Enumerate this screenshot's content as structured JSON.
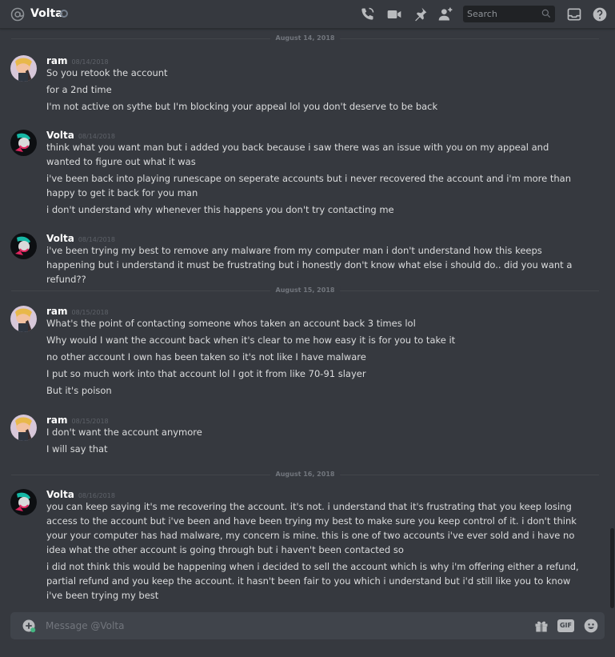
{
  "header": {
    "channel_name": "Volta",
    "search_placeholder": "Search",
    "icons": [
      "at-icon",
      "status-offline-icon",
      "call-icon",
      "video-icon",
      "pin-icon",
      "add-friend-icon",
      "search-icon",
      "inbox-icon",
      "help-icon"
    ]
  },
  "messages": {
    "divider_1": "August 14, 2018",
    "divider_2": "August 15, 2018",
    "divider_3": "August 16, 2018",
    "groups": [
      {
        "author": "ram",
        "timestamp": "08/14/2018",
        "lines": [
          "So you retook the account",
          "for a 2nd time",
          "I'm not active on sythe but I'm blocking your appeal lol you don't deserve to be back"
        ]
      },
      {
        "author": "Volta",
        "timestamp": "08/14/2018",
        "lines": [
          "think what you want man but i added you back because i saw there was an issue with you on my appeal and wanted to figure out what it was",
          "i've been back into playing runescape on seperate accounts but i never recovered the account and i'm more than happy to get it back for you man",
          "i don't understand why whenever this happens you don't try contacting me"
        ]
      },
      {
        "author": "Volta",
        "timestamp": "08/14/2018",
        "lines": [
          "i've been trying my best to remove any malware from my computer man i don't understand how this keeps happening but i understand it must be frustrating but i honestly don't know what else i should do.. did you want a refund??"
        ]
      },
      {
        "author": "ram",
        "timestamp": "08/15/2018",
        "lines": [
          "What's the point of contacting someone whos taken an account back 3 times lol",
          "Why would I want the account back when it's clear to me how easy it is for you to take it",
          "no other account I own has been taken so it's not like I have malware",
          "I put so much work into that account lol I got it from like 70-91 slayer",
          "But it's poison"
        ]
      },
      {
        "author": "ram",
        "timestamp": "08/15/2018",
        "lines": [
          "I don't want the account anymore",
          "I will say that"
        ]
      },
      {
        "author": "Volta",
        "timestamp": "08/16/2018",
        "lines": [
          "you can keep saying it's me recovering the account. it's not. i understand that it's frustrating that you keep losing access to the account but i've been and have been trying my best to make sure you keep control of it. i don't think your your computer has had malware, my concern is mine. this is one of two accounts i've ever sold and i have no idea what the other account is going through but i haven't been contacted so",
          "i did not think this would be happening when i decided to sell the account which is why i'm offering either a refund, partial refund and you keep the account. it hasn't been fair to you which i understand but i'd still like you to know i've been trying my best"
        ]
      }
    ]
  },
  "composer": {
    "placeholder": "Message @Volta",
    "icons": [
      "upload-icon",
      "gift-icon",
      "gif-icon",
      "emoji-icon"
    ],
    "gif_label": "GIF"
  },
  "colors": {
    "background": "#36393f",
    "header_bg": "#36393f",
    "composer_bg": "#40444b",
    "search_bg": "#202225",
    "text": "#dcddde",
    "author": "#ffffff",
    "muted": "#72767d"
  }
}
